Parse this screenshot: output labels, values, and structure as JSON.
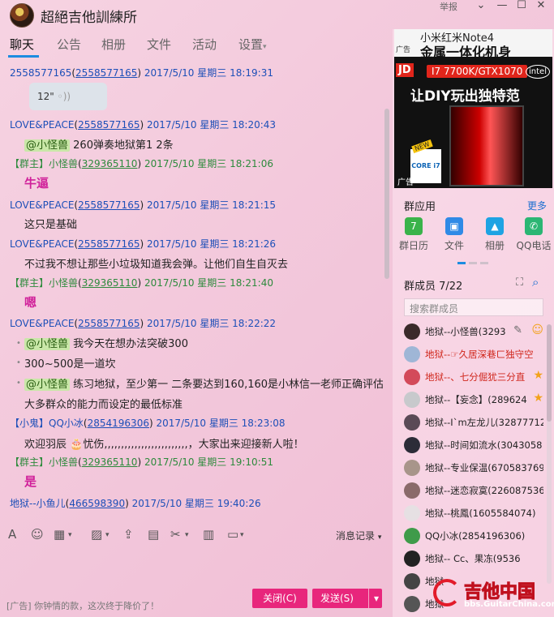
{
  "window": {
    "title": "超絕吉他訓練所",
    "report": "举报",
    "controls": {
      "shrink": "⌄",
      "minimize": "—",
      "maximize": "☐",
      "close": "✕"
    }
  },
  "tabs": [
    "聊天",
    "公告",
    "相册",
    "文件",
    "活动",
    "设置"
  ],
  "chat": {
    "h1": {
      "name": "2558577165",
      "id": "2558577165",
      "time": "2017/5/10 星期三 18:19:31"
    },
    "voice": "12\"",
    "h2": {
      "name": "LOVE&PEACE",
      "id": "2558577165",
      "time": "2017/5/10 星期三 18:20:43"
    },
    "m2_mention": "@小怪兽",
    "m2_text": " 260弹奏地狱第1 2条",
    "h3": {
      "role": "【群主】",
      "name": "小怪兽",
      "id": "329365110",
      "time": "2017/5/10 星期三 18:21:06"
    },
    "m3": "牛逼",
    "h4": {
      "name": "LOVE&PEACE",
      "id": "2558577165",
      "time": "2017/5/10 星期三 18:21:15"
    },
    "m4": "这只是基础",
    "h5": {
      "name": "LOVE&PEACE",
      "id": "2558577165",
      "time": "2017/5/10 星期三 18:21:26"
    },
    "m5": "不过我不想让那些小垃圾知道我会弹。让他们自生自灭去",
    "h6": {
      "role": "【群主】",
      "name": "小怪兽",
      "id": "329365110",
      "time": "2017/5/10 星期三 18:21:40"
    },
    "m6": "嗯",
    "h7": {
      "name": "LOVE&PEACE",
      "id": "2558577165",
      "time": "2017/5/10 星期三 18:22:22"
    },
    "m7a_mention": "@小怪兽",
    "m7a_text": " 我今天在想办法突破300",
    "m7b": "300~500是一道坎",
    "m7c_mention": "@小怪兽",
    "m7c_text": " 练习地狱，至少第一 二条要达到160,160是小林信一老师正确评估",
    "m7d": "大多群众的能力而设定的最低标准",
    "h8": {
      "role": "【小鬼】",
      "name": "QQ小冰",
      "id": "2854196306",
      "time": "2017/5/10 星期三 18:23:08"
    },
    "m8": "欢迎羽辰 🎂忧伤,,,,,,,,,,,,,,,,,,,,,,,,,，大家出来迎接新人啦！",
    "h9": {
      "role": "【群主】",
      "name": "小怪兽",
      "id": "329365110",
      "time": "2017/5/10 星期三 19:10:51"
    },
    "m9": "是",
    "h10": {
      "name": "地狱--小鱼儿",
      "id": "466598390",
      "time": "2017/5/10 星期三 19:40:26"
    }
  },
  "toolbar": {
    "icons": [
      "font-icon",
      "emoji-icon",
      "gif-icon",
      "image-icon",
      "upload-icon",
      "gift-icon",
      "scissors-icon",
      "red-packet-icon",
      "screen-icon"
    ],
    "message_record": "消息记录",
    "dropdown": "▾"
  },
  "footer": {
    "ad_text": "[广告] 你钟情的款，这次终于降价了！",
    "close_label": "关闭(C)",
    "send_label": "发送(S)",
    "send_arrow": "▾"
  },
  "ad": {
    "line1": "小米红米Note4",
    "line2": "金属一体化机身",
    "tag": "广告",
    "jd": "JD",
    "cpu": "I7 7700K/GTX1070",
    "intel": "intel",
    "headline": "让DIY玩出独特范",
    "core": "CORE i7",
    "new": "NEW"
  },
  "apps": {
    "header": "群应用",
    "more": "更多",
    "items": [
      {
        "label": "群日历",
        "glyph": "7",
        "color": "#3ab34a"
      },
      {
        "label": "文件",
        "glyph": "▣",
        "color": "#2f8ae6"
      },
      {
        "label": "相册",
        "glyph": "▲",
        "color": "#1ea3e3"
      },
      {
        "label": "QQ电话",
        "glyph": "✆",
        "color": "#2bb673"
      }
    ]
  },
  "members": {
    "header": "群成员 7/22",
    "search_placeholder": "搜索群成员",
    "list": [
      {
        "name": "地狱--小怪兽(3293",
        "red": false
      },
      {
        "name": "地狱--☞久居深巷ㄈ独守空",
        "red": true
      },
      {
        "name": "地狱--、七分倔犹三分直",
        "red": true
      },
      {
        "name": "地狱--【妄念】(289624",
        "red": false
      },
      {
        "name": "地狱--I`m左龙儿(328777126)",
        "red": false
      },
      {
        "name": "地狱--时间如流水(3043058",
        "red": false
      },
      {
        "name": "地狱--专业保温(670583769)",
        "red": false
      },
      {
        "name": "地狱--迷恋寂寞(2260875365)",
        "red": false
      },
      {
        "name": "地狱--桃鳳(1605584074)",
        "red": false
      },
      {
        "name": "QQ小冰(2854196306)",
        "red": false
      },
      {
        "name": "地狱--       Cc、果冻(9536",
        "red": false
      },
      {
        "name": "地狱",
        "red": false
      },
      {
        "name": "地狱",
        "red": false
      }
    ]
  },
  "watermark": {
    "text": "吉他中国",
    "url": "bbs.GuitarChina.com"
  }
}
